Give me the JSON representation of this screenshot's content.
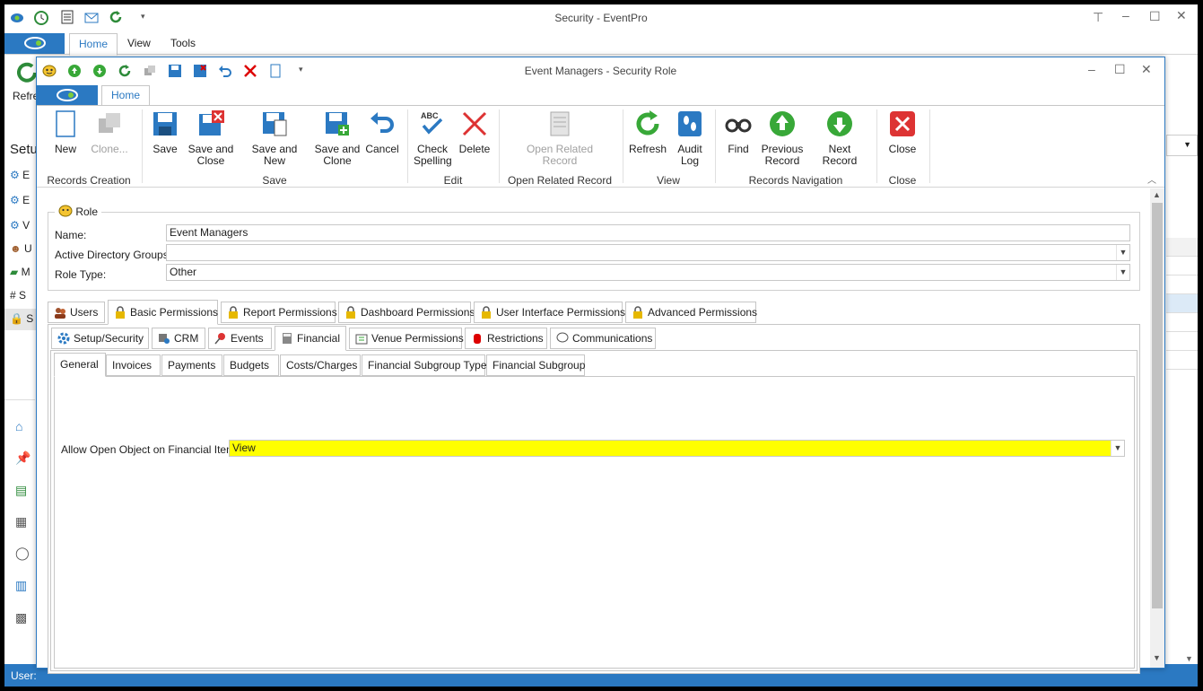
{
  "app": {
    "title": "Security - EventPro",
    "tabs": [
      "Home",
      "View",
      "Tools"
    ],
    "behind_labels": {
      "refresh": "Refre",
      "setup": "Setu",
      "sidebar_initials": [
        "E",
        "E",
        "V",
        "U",
        "M",
        "S",
        "S"
      ]
    },
    "status_label": "User:"
  },
  "dialog": {
    "title": "Event Managers - Security Role",
    "home_tab": "Home",
    "ribbon": {
      "groups": {
        "records_creation": "Records Creation",
        "save": "Save",
        "edit": "Edit",
        "open_related": "Open Related Record",
        "view": "View",
        "records_navigation": "Records Navigation",
        "close": "Close"
      },
      "buttons": {
        "new": "New",
        "clone": "Clone...",
        "save": "Save",
        "save_close_1": "Save and",
        "save_close_2": "Close",
        "save_new": "Save and New",
        "save_clone_1": "Save and",
        "save_clone_2": "Clone",
        "cancel": "Cancel",
        "check_1": "Check",
        "check_2": "Spelling",
        "delete": "Delete",
        "open_related_1": "Open Related",
        "open_related_2": "Record",
        "refresh": "Refresh",
        "audit_1": "Audit",
        "audit_2": "Log",
        "find": "Find",
        "prev_1": "Previous",
        "prev_2": "Record",
        "next": "Next Record",
        "close": "Close"
      }
    },
    "role": {
      "section": "Role",
      "name_label": "Name:",
      "name_value": "Event Managers",
      "ad_label": "Active Directory Groups:",
      "ad_value": "",
      "type_label": "Role Type:",
      "type_value": "Other"
    },
    "main_tabs": [
      "Users",
      "Basic Permissions",
      "Report Permissions",
      "Dashboard Permissions",
      "User Interface Permissions",
      "Advanced Permissions"
    ],
    "sub_tabs": [
      "Setup/Security",
      "CRM",
      "Events",
      "Financial",
      "Venue Permissions",
      "Restrictions",
      "Communications"
    ],
    "fin_tabs": [
      "General",
      "Invoices",
      "Payments",
      "Budgets",
      "Costs/Charges",
      "Financial Subgroup Type",
      "Financial Subgroup"
    ],
    "general": {
      "label": "Allow Open Object on Financial Items:",
      "value": "View"
    }
  }
}
